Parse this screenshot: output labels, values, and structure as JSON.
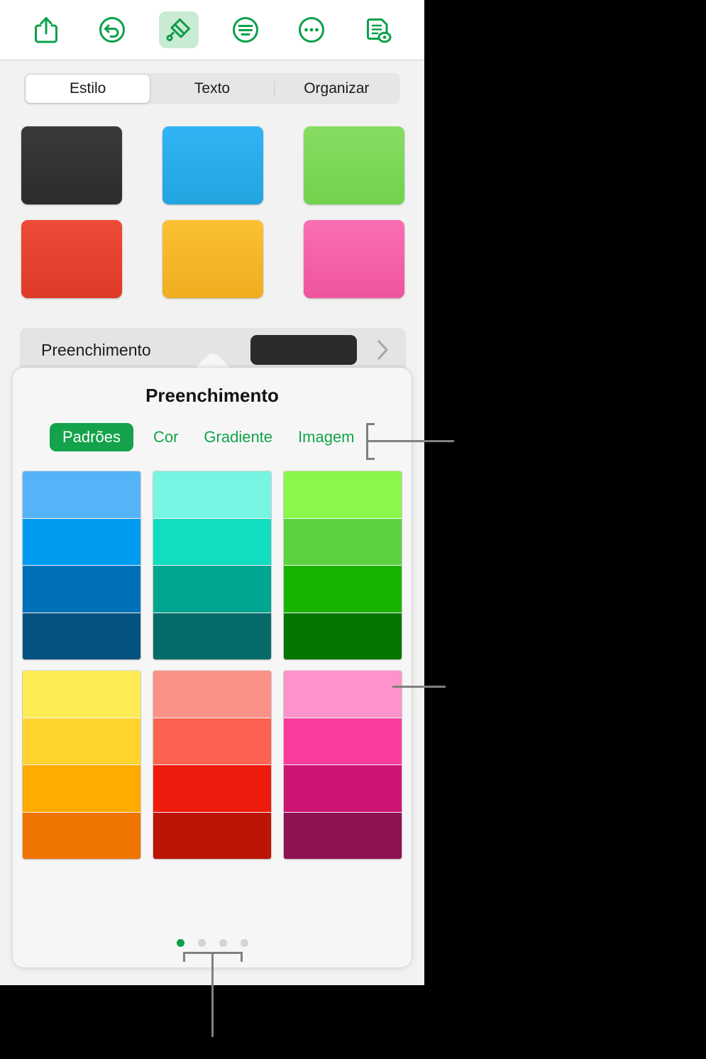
{
  "app": {
    "accent": "#14a34b",
    "panel_bg": "#f2f2f2",
    "popover_bg": "#f6f6f6"
  },
  "toolbar": {
    "items": [
      {
        "name": "share-icon",
        "label": "Compartilhar",
        "active": false
      },
      {
        "name": "undo-icon",
        "label": "Desfazer",
        "active": false
      },
      {
        "name": "brush-icon",
        "label": "Formato",
        "active": true
      },
      {
        "name": "insert-icon",
        "label": "Inserir",
        "active": false
      },
      {
        "name": "more-icon",
        "label": "Mais",
        "active": false
      },
      {
        "name": "document-view-icon",
        "label": "Visualizar documento",
        "active": false
      }
    ]
  },
  "tabs": {
    "items": [
      {
        "label": "Estilo",
        "selected": true
      },
      {
        "label": "Texto",
        "selected": false
      },
      {
        "label": "Organizar",
        "selected": false
      }
    ]
  },
  "styles": {
    "swatches": [
      {
        "name": "style-swatch-dark",
        "color": "#343434",
        "top": "#3a3a3a",
        "bottom": "#2c2c2c"
      },
      {
        "name": "style-swatch-blue",
        "color": "#29ace3",
        "top": "#31b4f5",
        "bottom": "#22a4e0"
      },
      {
        "name": "style-swatch-green",
        "color": "#7cd957",
        "top": "#87dd63",
        "bottom": "#72d24d"
      },
      {
        "name": "style-swatch-red",
        "color": "#e8402e",
        "top": "#ee4a38",
        "bottom": "#de3a28"
      },
      {
        "name": "style-swatch-yellow",
        "color": "#f6b72a",
        "top": "#fbc034",
        "bottom": "#efae20"
      },
      {
        "name": "style-swatch-pink",
        "color": "#f660aa",
        "top": "#f96eb4",
        "bottom": "#ef559f"
      }
    ]
  },
  "fill_row": {
    "label": "Preenchimento",
    "chip_color": "#2b2b2b",
    "chevron": "›"
  },
  "popover": {
    "title": "Preenchimento",
    "fill_types": [
      {
        "label": "Padrões",
        "selected": true
      },
      {
        "label": "Cor",
        "selected": false
      },
      {
        "label": "Gradiente",
        "selected": false
      },
      {
        "label": "Imagem",
        "selected": false
      }
    ],
    "patterns": [
      {
        "name": "pattern-blue",
        "bands": [
          "#55b4f7",
          "#009cf2",
          "#0071b8",
          "#04527f"
        ]
      },
      {
        "name": "pattern-turquoise",
        "bands": [
          "#76f5e2",
          "#13ddc0",
          "#01a691",
          "#066a68"
        ]
      },
      {
        "name": "pattern-green",
        "bands": [
          "#8bf74b",
          "#5dd23e",
          "#19b400",
          "#067500"
        ]
      },
      {
        "name": "pattern-yellow",
        "bands": [
          "#fdec54",
          "#fed42c",
          "#ffab00",
          "#f07400"
        ]
      },
      {
        "name": "pattern-coral",
        "bands": [
          "#fb9187",
          "#fb6250",
          "#ee1b0c",
          "#bc1503"
        ]
      },
      {
        "name": "pattern-pink",
        "bands": [
          "#fc93cb",
          "#fb3c9f",
          "#cc1574",
          "#8e1152"
        ]
      }
    ],
    "page_dots": {
      "count": 4,
      "active_index": 0,
      "active_color": "#0aa049",
      "inactive_color": "#d4d4d4"
    }
  },
  "callouts": {
    "color": "#808080",
    "items": [
      {
        "name": "callout-fill-types",
        "shape": "bracket"
      },
      {
        "name": "callout-pattern",
        "shape": "line"
      },
      {
        "name": "callout-page-dots",
        "shape": "bracket"
      }
    ]
  }
}
